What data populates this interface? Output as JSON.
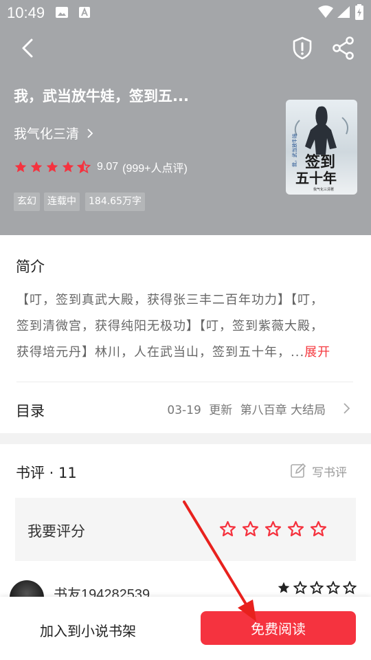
{
  "status_bar": {
    "time": "10:49"
  },
  "book": {
    "title": "我，武当放牛娃，签到五...",
    "author": "我气化三清",
    "rating": "9.07",
    "rating_count": "(999+人点评)",
    "star_rating": 4.5,
    "tags": [
      "玄幻",
      "连载中",
      "184.65万字"
    ],
    "cover": {
      "title_lines": [
        "签到",
        "五十年"
      ],
      "subtitle": "我，武当放牛娃",
      "author_line": "我气化三清著"
    }
  },
  "intro": {
    "heading": "简介",
    "lines": [
      "【叮，签到真武大殿，获得张三丰二百年功力】【叮，",
      "签到清微宫，获得纯阳无极功】【叮，签到紫薇大殿，",
      "获得培元丹】林川，人在武当山，签到五十年，..."
    ],
    "more_label": "展开"
  },
  "catalog": {
    "label": "目录",
    "update_date": "03-19",
    "update_word": "更新",
    "latest_chapter": "第八百章 大结局"
  },
  "reviews": {
    "heading": "书评 · 11",
    "write_label": "写书评",
    "rate_prompt": "我要评分",
    "first_review": {
      "user": "书友194282539",
      "stars": 5
    }
  },
  "bottom_bar": {
    "add_shelf_label": "加入到小说书架",
    "read_label": "免费阅读"
  },
  "colors": {
    "accent": "#f5333f",
    "header_bg": "#a4a6a9",
    "annotation_arrow": "#e8211d"
  },
  "icons": [
    "back-icon",
    "report-shield-icon",
    "share-icon",
    "chevron-right-icon",
    "edit-icon",
    "star-icon"
  ]
}
